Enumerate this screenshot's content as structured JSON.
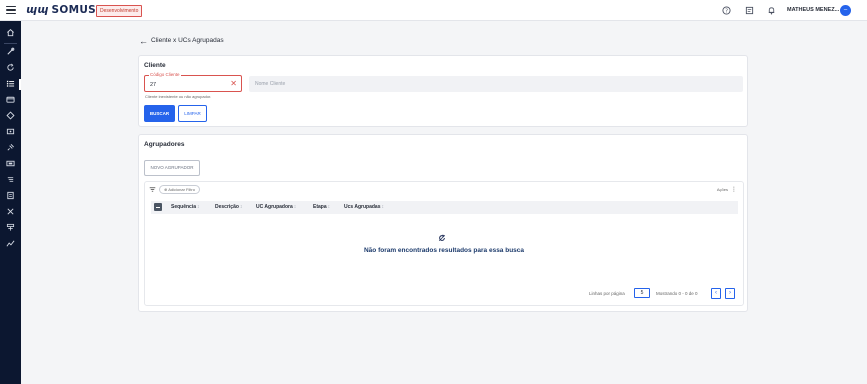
{
  "header": {
    "logo_mark": "ɰɰ",
    "logo_text": "SOMUS.",
    "env_badge": "Desenvolvimento",
    "user_name": "MATHEUS MENEZ...",
    "avatar_initial": "–"
  },
  "sidebar": {
    "items": [
      "home-icon",
      "tools-icon",
      "refresh-icon",
      "list-icon",
      "card-icon",
      "circle-icon",
      "tag-icon",
      "plug-icon",
      "ticket-icon",
      "sort-icon",
      "document-icon",
      "wrench-icon",
      "hierarchy-icon",
      "trend-icon"
    ]
  },
  "breadcrumb": {
    "back_glyph": "←",
    "title": "Cliente x UCs Agrupadas"
  },
  "cliente": {
    "title": "Cliente",
    "codigo_label": "Código Cliente",
    "codigo_value": "27",
    "codigo_error": "Cliente inexistente ou não agrupador.",
    "nome_placeholder": "Nome Cliente",
    "buscar_label": "BUSCAR",
    "limpar_label": "LIMPAR"
  },
  "agrupadores": {
    "title": "Agrupadores",
    "novo_label": "NOVO AGRUPADOR",
    "add_filter_label": "⊕ Adicionar Filtro",
    "acoes_label": "Ações",
    "columns": [
      "Sequência",
      "Descrição",
      "UC Agrupadora",
      "Etapa",
      "Ucs Agrupadas"
    ],
    "sort_glyph": "↕",
    "empty_message": "Não foram encontrados resultados para essa busca",
    "rows_per_page_label": "Linhas por página",
    "rows_per_page_value": "5",
    "showing_label": "Mostrando 0 - 0 de 0"
  },
  "colors": {
    "primary": "#2563eb",
    "sidebar": "#0c1730",
    "error": "#d9534f",
    "brand": "#1c2b55"
  }
}
